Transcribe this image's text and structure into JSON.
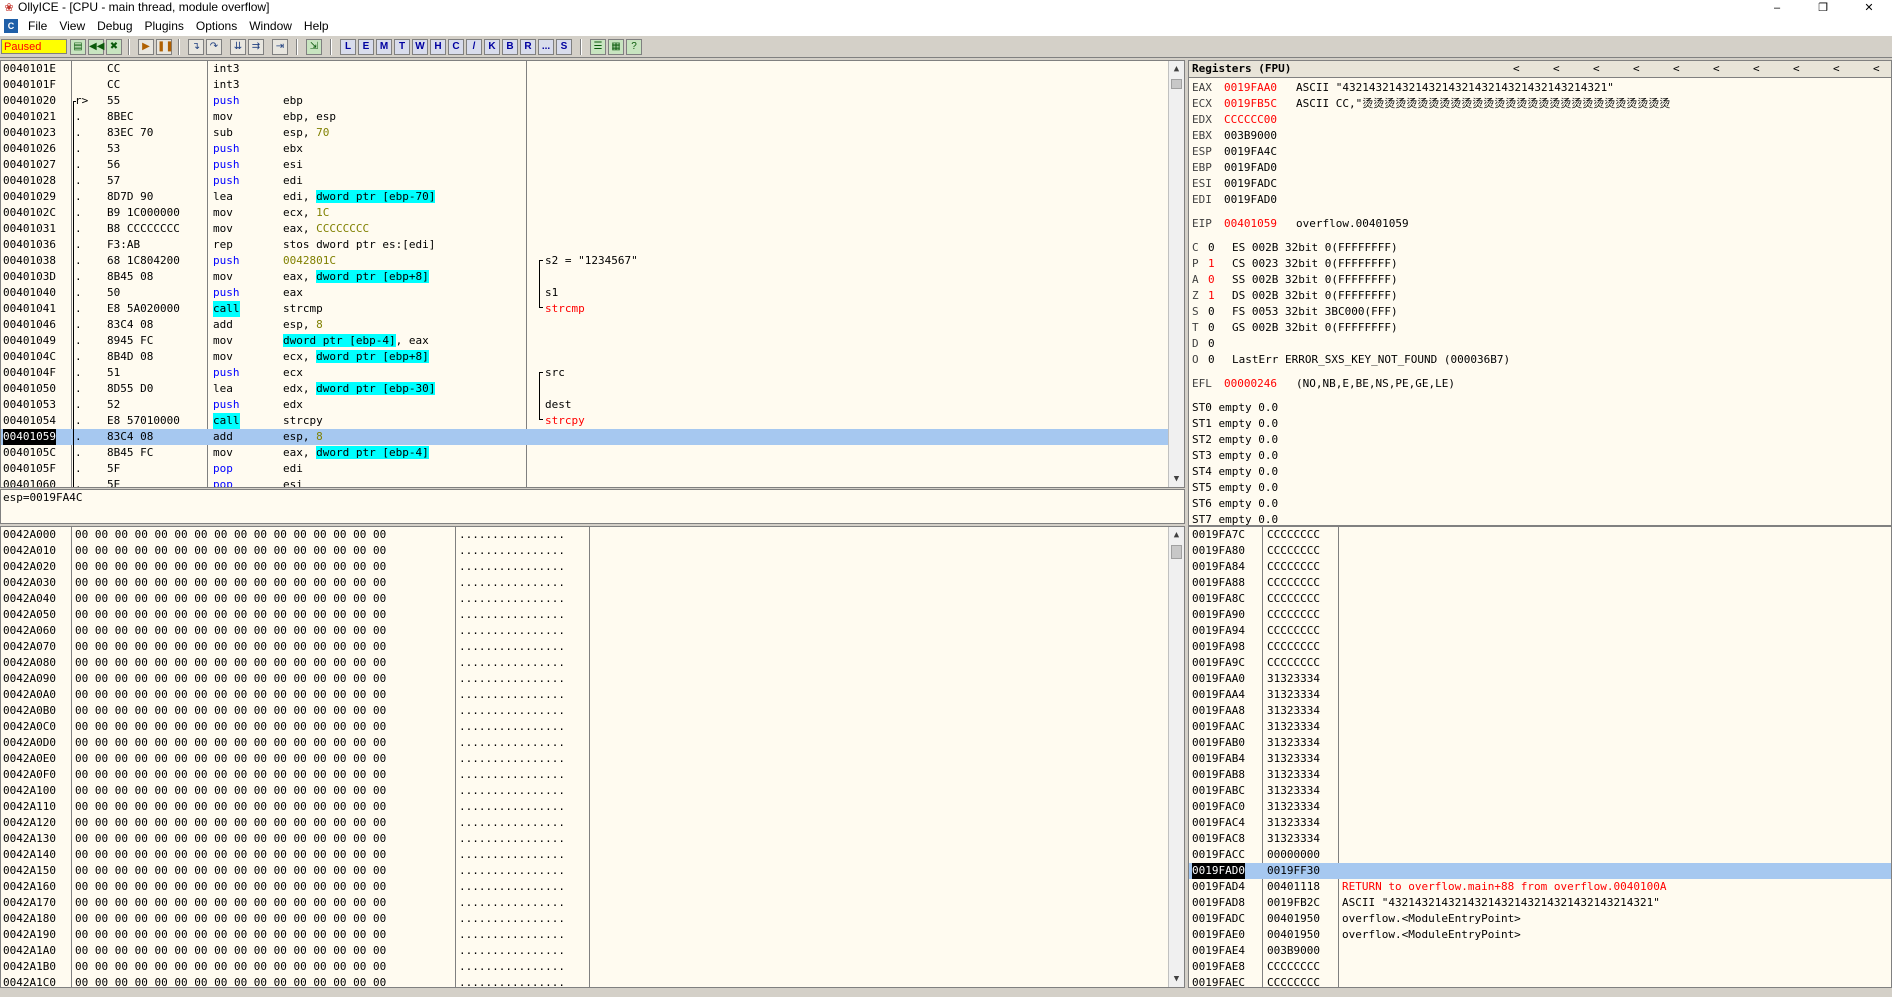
{
  "title": "OllyICE - [CPU - main thread, module overflow]",
  "window_controls": [
    "–",
    "❐",
    "✕"
  ],
  "menus": [
    "File",
    "View",
    "Debug",
    "Plugins",
    "Options",
    "Window",
    "Help"
  ],
  "status": "Paused",
  "toolbar_letters": [
    "L",
    "E",
    "M",
    "T",
    "W",
    "H",
    "C",
    "/",
    "K",
    "B",
    "R",
    "...",
    "S"
  ],
  "disasm": [
    {
      "addr": "0040101E",
      "mark": "",
      "hex": "CC",
      "mn": "int3",
      "ops": [],
      "cmt": ""
    },
    {
      "addr": "0040101F",
      "mark": "",
      "hex": "CC",
      "mn": "int3",
      "ops": [],
      "cmt": ""
    },
    {
      "addr": "00401020",
      "mark": "r>",
      "hex": "55",
      "mn": "push",
      "ops": [
        [
          "ebp",
          ""
        ]
      ],
      "cmt": ""
    },
    {
      "addr": "00401021",
      "mark": ".",
      "hex": "8BEC",
      "mn": "mov",
      "ops": [
        [
          "ebp, esp",
          ""
        ]
      ],
      "cmt": ""
    },
    {
      "addr": "00401023",
      "mark": ".",
      "hex": "83EC 70",
      "mn": "sub",
      "ops": [
        [
          "esp, ",
          ""
        ],
        [
          "70",
          "num"
        ]
      ],
      "cmt": ""
    },
    {
      "addr": "00401026",
      "mark": ".",
      "hex": "53",
      "mn": "push",
      "ops": [
        [
          "ebx",
          ""
        ]
      ],
      "cmt": ""
    },
    {
      "addr": "00401027",
      "mark": ".",
      "hex": "56",
      "mn": "push",
      "ops": [
        [
          "esi",
          ""
        ]
      ],
      "cmt": ""
    },
    {
      "addr": "00401028",
      "mark": ".",
      "hex": "57",
      "mn": "push",
      "ops": [
        [
          "edi",
          ""
        ]
      ],
      "cmt": ""
    },
    {
      "addr": "00401029",
      "mark": ".",
      "hex": "8D7D 90",
      "mn": "lea",
      "ops": [
        [
          "edi, ",
          ""
        ],
        [
          "dword ptr [ebp-70]",
          "cyan"
        ]
      ],
      "cmt": ""
    },
    {
      "addr": "0040102C",
      "mark": ".",
      "hex": "B9 1C000000",
      "mn": "mov",
      "ops": [
        [
          "ecx, ",
          ""
        ],
        [
          "1C",
          "num"
        ]
      ],
      "cmt": ""
    },
    {
      "addr": "00401031",
      "mark": ".",
      "hex": "B8 CCCCCCCC",
      "mn": "mov",
      "ops": [
        [
          "eax, ",
          ""
        ],
        [
          "CCCCCCCC",
          "num"
        ]
      ],
      "cmt": ""
    },
    {
      "addr": "00401036",
      "mark": ".",
      "hex": "F3:AB",
      "mn": "rep",
      "ops": [
        [
          "stos dword ptr es:[edi]",
          ""
        ]
      ],
      "cmt": ""
    },
    {
      "addr": "00401038",
      "mark": ".",
      "hex": "68 1C804200",
      "mn": "push",
      "ops": [
        [
          "0042801C",
          "num"
        ]
      ],
      "cmt": "s2 = \"1234567\""
    },
    {
      "addr": "0040103D",
      "mark": ".",
      "hex": "8B45 08",
      "mn": "mov",
      "ops": [
        [
          "eax, ",
          ""
        ],
        [
          "dword ptr [ebp+8]",
          "cyan"
        ]
      ],
      "cmt": ""
    },
    {
      "addr": "00401040",
      "mark": ".",
      "hex": "50",
      "mn": "push",
      "ops": [
        [
          "eax",
          ""
        ]
      ],
      "cmt": "s1"
    },
    {
      "addr": "00401041",
      "mark": ".",
      "hex": "E8 5A020000",
      "mn": "call",
      "ops": [
        [
          "strcmp",
          ""
        ]
      ],
      "cmt": "strcmp",
      "call": true
    },
    {
      "addr": "00401046",
      "mark": ".",
      "hex": "83C4 08",
      "mn": "add",
      "ops": [
        [
          "esp, ",
          ""
        ],
        [
          "8",
          "num"
        ]
      ],
      "cmt": ""
    },
    {
      "addr": "00401049",
      "mark": ".",
      "hex": "8945 FC",
      "mn": "mov",
      "ops": [
        [
          "dword ptr [ebp-4]",
          "cyan"
        ],
        [
          ", eax",
          ""
        ]
      ],
      "cmt": ""
    },
    {
      "addr": "0040104C",
      "mark": ".",
      "hex": "8B4D 08",
      "mn": "mov",
      "ops": [
        [
          "ecx, ",
          ""
        ],
        [
          "dword ptr [ebp+8]",
          "cyan"
        ]
      ],
      "cmt": ""
    },
    {
      "addr": "0040104F",
      "mark": ".",
      "hex": "51",
      "mn": "push",
      "ops": [
        [
          "ecx",
          ""
        ]
      ],
      "cmt": "src"
    },
    {
      "addr": "00401050",
      "mark": ".",
      "hex": "8D55 D0",
      "mn": "lea",
      "ops": [
        [
          "edx, ",
          ""
        ],
        [
          "dword ptr [ebp-30]",
          "cyan"
        ]
      ],
      "cmt": ""
    },
    {
      "addr": "00401053",
      "mark": ".",
      "hex": "52",
      "mn": "push",
      "ops": [
        [
          "edx",
          ""
        ]
      ],
      "cmt": "dest"
    },
    {
      "addr": "00401054",
      "mark": ".",
      "hex": "E8 57010000",
      "mn": "call",
      "ops": [
        [
          "strcpy",
          ""
        ]
      ],
      "cmt": "strcpy",
      "call": true
    },
    {
      "addr": "00401059",
      "mark": ".",
      "hex": "83C4 08",
      "mn": "add",
      "ops": [
        [
          "esp, ",
          ""
        ],
        [
          "8",
          "num"
        ]
      ],
      "cmt": "",
      "current": true
    },
    {
      "addr": "0040105C",
      "mark": ".",
      "hex": "8B45 FC",
      "mn": "mov",
      "ops": [
        [
          "eax, ",
          ""
        ],
        [
          "dword ptr [ebp-4]",
          "cyan"
        ]
      ],
      "cmt": ""
    },
    {
      "addr": "0040105F",
      "mark": ".",
      "hex": "5F",
      "mn": "pop",
      "ops": [
        [
          "edi",
          ""
        ]
      ],
      "cmt": ""
    },
    {
      "addr": "00401060",
      "mark": ".",
      "hex": "5E",
      "mn": "pop",
      "ops": [
        [
          "esi",
          ""
        ]
      ],
      "cmt": ""
    }
  ],
  "info_line": "esp=0019FA4C",
  "registers": {
    "header": "Registers (FPU)",
    "arrows": "<",
    "gpr": [
      {
        "name": "EAX",
        "val": "0019FAA0",
        "red": true,
        "rest": "ASCII \"4321432143214321432143214321432143214321\""
      },
      {
        "name": "ECX",
        "val": "0019FB5C",
        "red": true,
        "rest": "ASCII CC,\"烫烫烫烫烫烫烫烫烫烫烫烫烫烫烫烫烫烫烫烫烫烫烫烫烫烫烫烫"
      },
      {
        "name": "EDX",
        "val": "CCCCCC00",
        "red": true,
        "rest": ""
      },
      {
        "name": "EBX",
        "val": "003B9000",
        "red": false,
        "rest": ""
      },
      {
        "name": "ESP",
        "val": "0019FA4C",
        "red": false,
        "rest": ""
      },
      {
        "name": "EBP",
        "val": "0019FAD0",
        "red": false,
        "rest": ""
      },
      {
        "name": "ESI",
        "val": "0019FADC",
        "red": false,
        "rest": ""
      },
      {
        "name": "EDI",
        "val": "0019FAD0",
        "red": false,
        "rest": ""
      }
    ],
    "eip": {
      "name": "EIP",
      "val": "00401059",
      "rest": "overflow.00401059"
    },
    "flags": [
      {
        "f": "C",
        "v": "0",
        "red": false,
        "seg": "ES 002B 32bit 0(FFFFFFFF)"
      },
      {
        "f": "P",
        "v": "1",
        "red": true,
        "seg": "CS 0023 32bit 0(FFFFFFFF)"
      },
      {
        "f": "A",
        "v": "0",
        "red": true,
        "seg": "SS 002B 32bit 0(FFFFFFFF)"
      },
      {
        "f": "Z",
        "v": "1",
        "red": true,
        "seg": "DS 002B 32bit 0(FFFFFFFF)"
      },
      {
        "f": "S",
        "v": "0",
        "red": false,
        "seg": "FS 0053 32bit 3BC000(FFF)"
      },
      {
        "f": "T",
        "v": "0",
        "red": false,
        "seg": "GS 002B 32bit 0(FFFFFFFF)"
      },
      {
        "f": "D",
        "v": "0",
        "red": false,
        "seg": ""
      },
      {
        "f": "O",
        "v": "0",
        "red": false,
        "seg": "LastErr ERROR_SXS_KEY_NOT_FOUND (000036B7)"
      }
    ],
    "efl": {
      "name": "EFL",
      "val": "00000246",
      "rest": "(NO,NB,E,BE,NS,PE,GE,LE)"
    },
    "fpu": [
      "ST0 empty 0.0",
      "ST1 empty 0.0",
      "ST2 empty 0.0",
      "ST3 empty 0.0",
      "ST4 empty 0.0",
      "ST5 empty 0.0",
      "ST6 empty 0.0",
      "ST7 empty 0.0"
    ]
  },
  "dump": {
    "addrs": [
      "0042A000",
      "0042A010",
      "0042A020",
      "0042A030",
      "0042A040",
      "0042A050",
      "0042A060",
      "0042A070",
      "0042A080",
      "0042A090",
      "0042A0A0",
      "0042A0B0",
      "0042A0C0",
      "0042A0D0",
      "0042A0E0",
      "0042A0F0",
      "0042A100",
      "0042A110",
      "0042A120",
      "0042A130",
      "0042A140",
      "0042A150",
      "0042A160",
      "0042A170",
      "0042A180",
      "0042A190",
      "0042A1A0",
      "0042A1B0",
      "0042A1C0"
    ],
    "hex": "00 00 00 00 00 00 00 00 00 00 00 00 00 00 00 00",
    "ascii": "................"
  },
  "stack": [
    {
      "addr": "0019FA7C",
      "val": "CCCCCCCC",
      "cmt": ""
    },
    {
      "addr": "0019FA80",
      "val": "CCCCCCCC",
      "cmt": ""
    },
    {
      "addr": "0019FA84",
      "val": "CCCCCCCC",
      "cmt": ""
    },
    {
      "addr": "0019FA88",
      "val": "CCCCCCCC",
      "cmt": ""
    },
    {
      "addr": "0019FA8C",
      "val": "CCCCCCCC",
      "cmt": ""
    },
    {
      "addr": "0019FA90",
      "val": "CCCCCCCC",
      "cmt": ""
    },
    {
      "addr": "0019FA94",
      "val": "CCCCCCCC",
      "cmt": ""
    },
    {
      "addr": "0019FA98",
      "val": "CCCCCCCC",
      "cmt": ""
    },
    {
      "addr": "0019FA9C",
      "val": "CCCCCCCC",
      "cmt": ""
    },
    {
      "addr": "0019FAA0",
      "val": "31323334",
      "cmt": ""
    },
    {
      "addr": "0019FAA4",
      "val": "31323334",
      "cmt": ""
    },
    {
      "addr": "0019FAA8",
      "val": "31323334",
      "cmt": ""
    },
    {
      "addr": "0019FAAC",
      "val": "31323334",
      "cmt": ""
    },
    {
      "addr": "0019FAB0",
      "val": "31323334",
      "cmt": ""
    },
    {
      "addr": "0019FAB4",
      "val": "31323334",
      "cmt": ""
    },
    {
      "addr": "0019FAB8",
      "val": "31323334",
      "cmt": ""
    },
    {
      "addr": "0019FABC",
      "val": "31323334",
      "cmt": ""
    },
    {
      "addr": "0019FAC0",
      "val": "31323334",
      "cmt": ""
    },
    {
      "addr": "0019FAC4",
      "val": "31323334",
      "cmt": ""
    },
    {
      "addr": "0019FAC8",
      "val": "31323334",
      "cmt": ""
    },
    {
      "addr": "0019FACC",
      "val": "00000000",
      "cmt": ""
    },
    {
      "addr": "0019FAD0",
      "val": "0019FF30",
      "cmt": "",
      "current": true
    },
    {
      "addr": "0019FAD4",
      "val": "00401118",
      "cmt": "RETURN to overflow.main+88 from overflow.0040100A",
      "red": true
    },
    {
      "addr": "0019FAD8",
      "val": "0019FB2C",
      "cmt": "ASCII \"4321432143214321432143214321432143214321\""
    },
    {
      "addr": "0019FADC",
      "val": "00401950",
      "cmt": "overflow.<ModuleEntryPoint>"
    },
    {
      "addr": "0019FAE0",
      "val": "00401950",
      "cmt": "overflow.<ModuleEntryPoint>"
    },
    {
      "addr": "0019FAE4",
      "val": "003B9000",
      "cmt": ""
    },
    {
      "addr": "0019FAE8",
      "val": "CCCCCCCC",
      "cmt": ""
    },
    {
      "addr": "0019FAEC",
      "val": "CCCCCCCC",
      "cmt": ""
    }
  ]
}
